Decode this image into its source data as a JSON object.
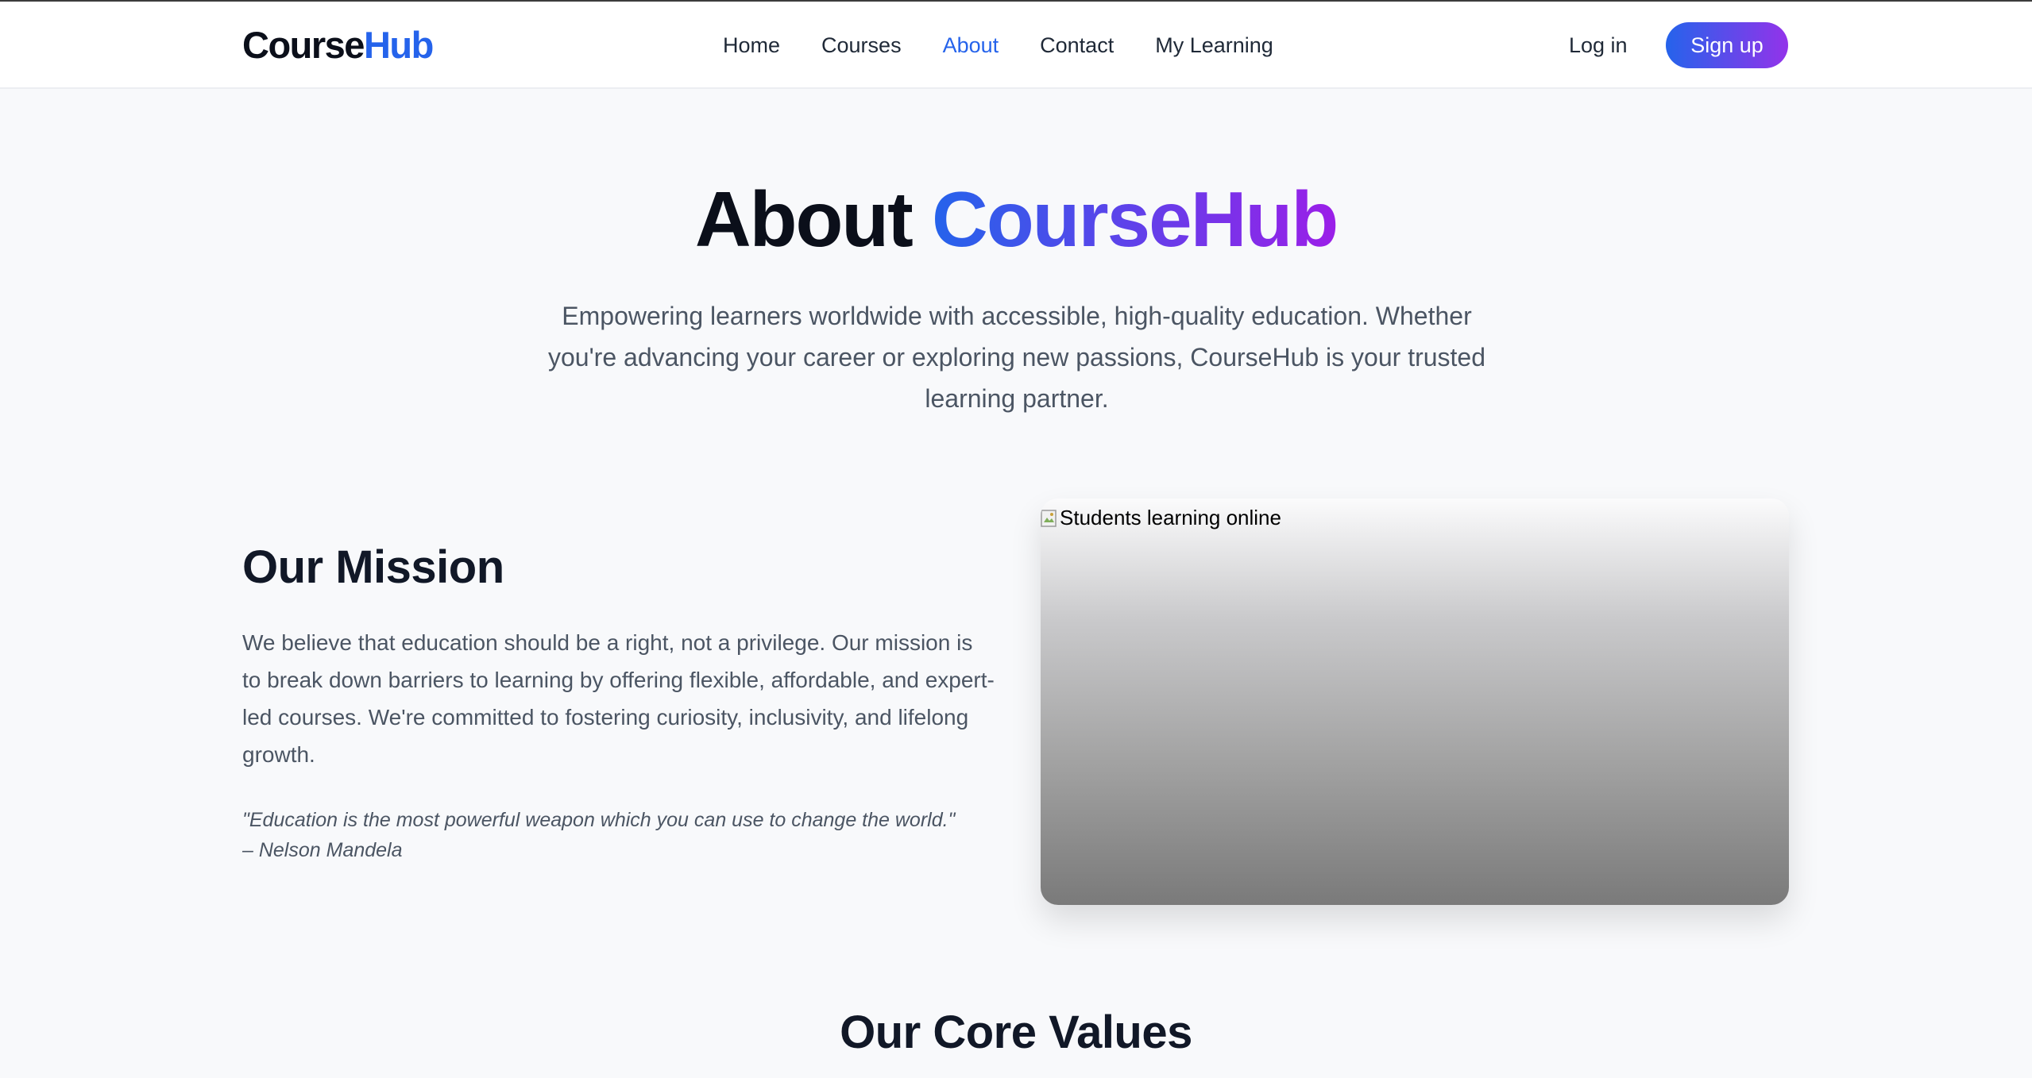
{
  "header": {
    "logo_part1": "Course",
    "logo_part2": "Hub",
    "nav": [
      {
        "label": "Home"
      },
      {
        "label": "Courses"
      },
      {
        "label": "About"
      },
      {
        "label": "Contact"
      },
      {
        "label": "My Learning"
      }
    ],
    "active_nav": "About",
    "login_label": "Log in",
    "signup_label": "Sign up"
  },
  "hero": {
    "title_part1": "About",
    "title_part2": "CourseHub",
    "subtitle": "Empowering learners worldwide with accessible, high-quality education. Whether you're advancing your career or exploring new passions, CourseHub is your trusted learning partner."
  },
  "mission": {
    "title": "Our Mission",
    "body": "We believe that education should be a right, not a privilege. Our mission is to break down barriers to learning by offering flexible, affordable, and expert-led courses. We're committed to fostering curiosity, inclusivity, and lifelong growth.",
    "quote_text": "\"Education is the most powerful weapon which you can use to change the world.\"",
    "quote_author": "– Nelson Mandela",
    "image_alt": "Students learning online"
  },
  "values": {
    "title": "Our Core Values"
  },
  "colors": {
    "accent_blue": "#2563eb",
    "accent_purple": "#9333ea",
    "page_bg": "#f8f9fb"
  },
  "icons": {
    "broken_image": "broken-image-icon"
  }
}
